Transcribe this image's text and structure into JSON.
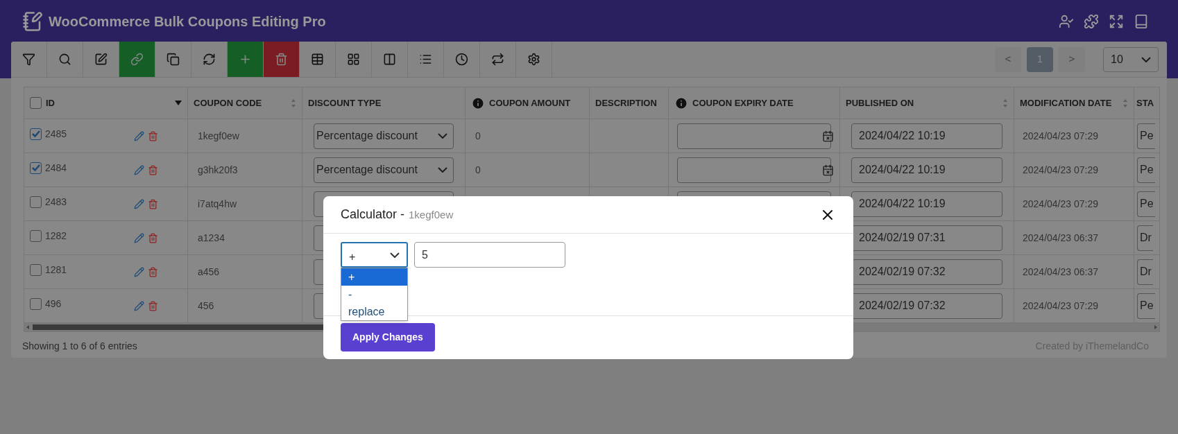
{
  "app": {
    "title": "WooCommerce Bulk Coupons Editing Pro"
  },
  "header_actions": [
    {
      "kind": "user-check"
    },
    {
      "kind": "puzzle"
    },
    {
      "kind": "expand"
    },
    {
      "kind": "book"
    }
  ],
  "toolbar": {
    "buttons": [
      {
        "kind": "filter"
      },
      {
        "kind": "search"
      },
      {
        "kind": "edit"
      },
      {
        "kind": "link",
        "color": "#155f27"
      },
      {
        "kind": "copy"
      },
      {
        "kind": "refresh"
      },
      {
        "kind": "add",
        "color": "#155f27"
      },
      {
        "kind": "delete",
        "color": "#7a1c22"
      },
      {
        "kind": "table"
      },
      {
        "kind": "grid"
      },
      {
        "kind": "columns"
      },
      {
        "kind": "list"
      },
      {
        "kind": "history"
      },
      {
        "kind": "swap"
      },
      {
        "kind": "settings"
      }
    ]
  },
  "pagination": {
    "prev": {
      "label": "<",
      "disabled": true
    },
    "pages": [
      {
        "label": "1",
        "selected": true
      }
    ],
    "next": {
      "label": ">",
      "disabled": true
    },
    "per_page": "10"
  },
  "table": {
    "select_all_checked": false,
    "columns": [
      {
        "label": "ID",
        "kind": "id"
      },
      {
        "label": "COUPON CODE",
        "sortable": true
      },
      {
        "label": "DISCOUNT TYPE"
      },
      {
        "label": "COUPON AMOUNT",
        "info": true
      },
      {
        "label": "DESCRIPTION"
      },
      {
        "label": "COUPON EXPIRY DATE",
        "info": true
      },
      {
        "label": "PUBLISHED ON",
        "sortable": true
      },
      {
        "label": "MODIFICATION DATE",
        "sortable": true
      },
      {
        "label": "STA"
      }
    ],
    "rows": [
      {
        "checked": true,
        "id": "2485",
        "code": "1kegf0ew",
        "discount_type": "Percentage discount",
        "amount": "0",
        "published": "2024/04/22 10:19",
        "modified": "2024/04/23 07:29",
        "status": "Pe"
      },
      {
        "checked": true,
        "id": "2484",
        "code": "g3hk20f3",
        "discount_type": "Percentage discount",
        "amount": "0",
        "published": "2024/04/22 10:19",
        "modified": "2024/04/23 07:29",
        "status": "Pe"
      },
      {
        "checked": false,
        "id": "2483",
        "code": "i7atq4hw",
        "published": "2024/04/22 10:19",
        "modified": "2024/04/23 07:29",
        "status": "Pe"
      },
      {
        "checked": false,
        "id": "1282",
        "code": "a1234",
        "published": "2024/02/19 07:31",
        "modified": "2024/04/23 06:37",
        "status": "Dr"
      },
      {
        "checked": false,
        "id": "1281",
        "code": "a456",
        "published": "2024/02/19 07:32",
        "modified": "2024/04/23 06:37",
        "status": "Dr"
      },
      {
        "checked": false,
        "id": "496",
        "code": "456",
        "published": "2024/02/19 07:32",
        "modified": "2024/04/23 07:29",
        "status": "Pe"
      }
    ]
  },
  "footer": {
    "summary": "Showing 1 to 6 of 6 entries",
    "credit": "Created by iThemelandCo"
  },
  "modal": {
    "title": "Calculator -",
    "subject": "1kegf0ew",
    "operator": {
      "value": "+",
      "open": true,
      "options": [
        {
          "label": "+",
          "selected": true
        },
        {
          "label": "-",
          "selected": false
        },
        {
          "label": "replace",
          "selected": false
        }
      ]
    },
    "amount": "5",
    "apply_button": "Apply Changes"
  }
}
